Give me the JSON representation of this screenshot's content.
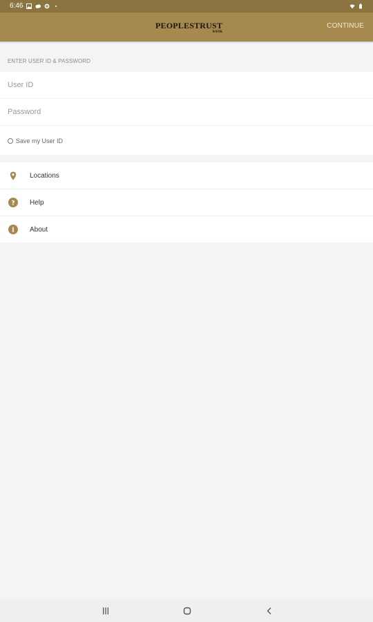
{
  "status_bar": {
    "time": "6:46"
  },
  "app_bar": {
    "logo_name": "PEOPLESTRUST",
    "logo_sub": "BANK",
    "continue_label": "CONTINUE"
  },
  "login": {
    "section_label": "ENTER USER ID & PASSWORD",
    "user_id_placeholder": "User ID",
    "password_placeholder": "Password",
    "save_user_id_label": "Save my User ID"
  },
  "menu": {
    "items": [
      {
        "label": "Locations",
        "icon": "location-pin-icon"
      },
      {
        "label": "Help",
        "icon": "help-icon"
      },
      {
        "label": "About",
        "icon": "info-icon"
      }
    ]
  },
  "colors": {
    "brand_gold": "#a6894f",
    "status_bar": "#8c7440",
    "icon_gold": "#a6894f"
  }
}
